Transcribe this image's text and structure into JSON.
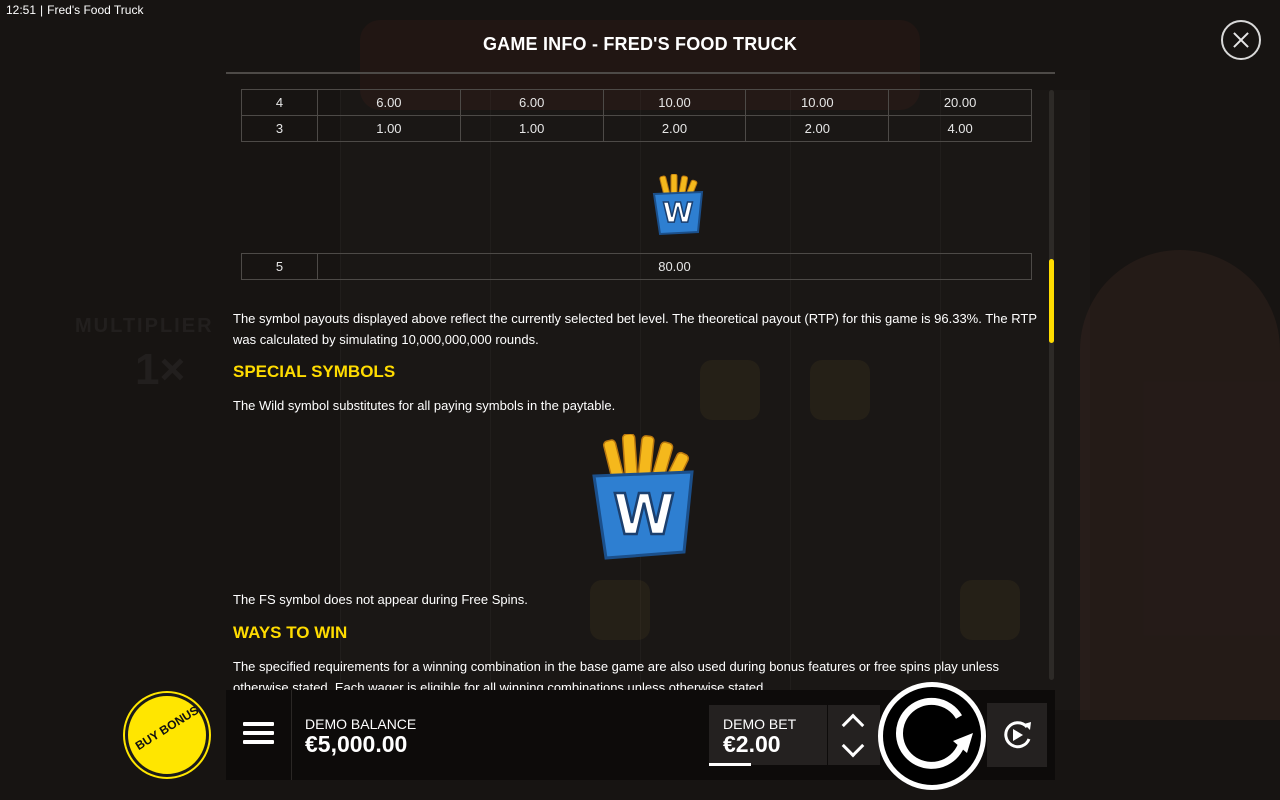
{
  "status_bar": {
    "time": "12:51",
    "app_name": "Fred's Food Truck"
  },
  "header": {
    "title": "GAME INFO - FRED'S FOOD TRUCK"
  },
  "paytable": {
    "rows": [
      [
        "4",
        "6.00",
        "6.00",
        "10.00",
        "10.00",
        "20.00"
      ],
      [
        "3",
        "1.00",
        "1.00",
        "2.00",
        "2.00",
        "4.00"
      ]
    ],
    "wild_row": [
      "5",
      "80.00"
    ]
  },
  "info": {
    "rtp_text": "The symbol payouts displayed above reflect the currently selected bet level. The theoretical payout (RTP) for this game is 96.33%. The RTP was calculated by simulating 10,000,000,000 rounds.",
    "special_symbols_heading": "SPECIAL SYMBOLS",
    "wild_text": "The Wild symbol substitutes for all paying symbols in the paytable.",
    "fs_text": "The FS symbol does not appear during Free Spins.",
    "ways_heading": "WAYS TO WIN",
    "ways_text": "The specified requirements for a winning combination in the base game are also used during bonus features or free spins play unless otherwise stated. Each wager is eligible for all winning combinations unless otherwise stated."
  },
  "wild_symbol": {
    "letter": "W"
  },
  "background": {
    "multiplier_label": "MULTIPLIER",
    "multiplier_value": "1×"
  },
  "bottom_bar": {
    "buy_bonus_label": "BUY BONUS",
    "balance_label": "DEMO BALANCE",
    "balance_value": "€5,000.00",
    "bet_label": "DEMO BET",
    "bet_value": "€2.00"
  },
  "colors": {
    "accent": "#ffdc00",
    "panel": "#0d0b0a",
    "background": "#171412"
  }
}
